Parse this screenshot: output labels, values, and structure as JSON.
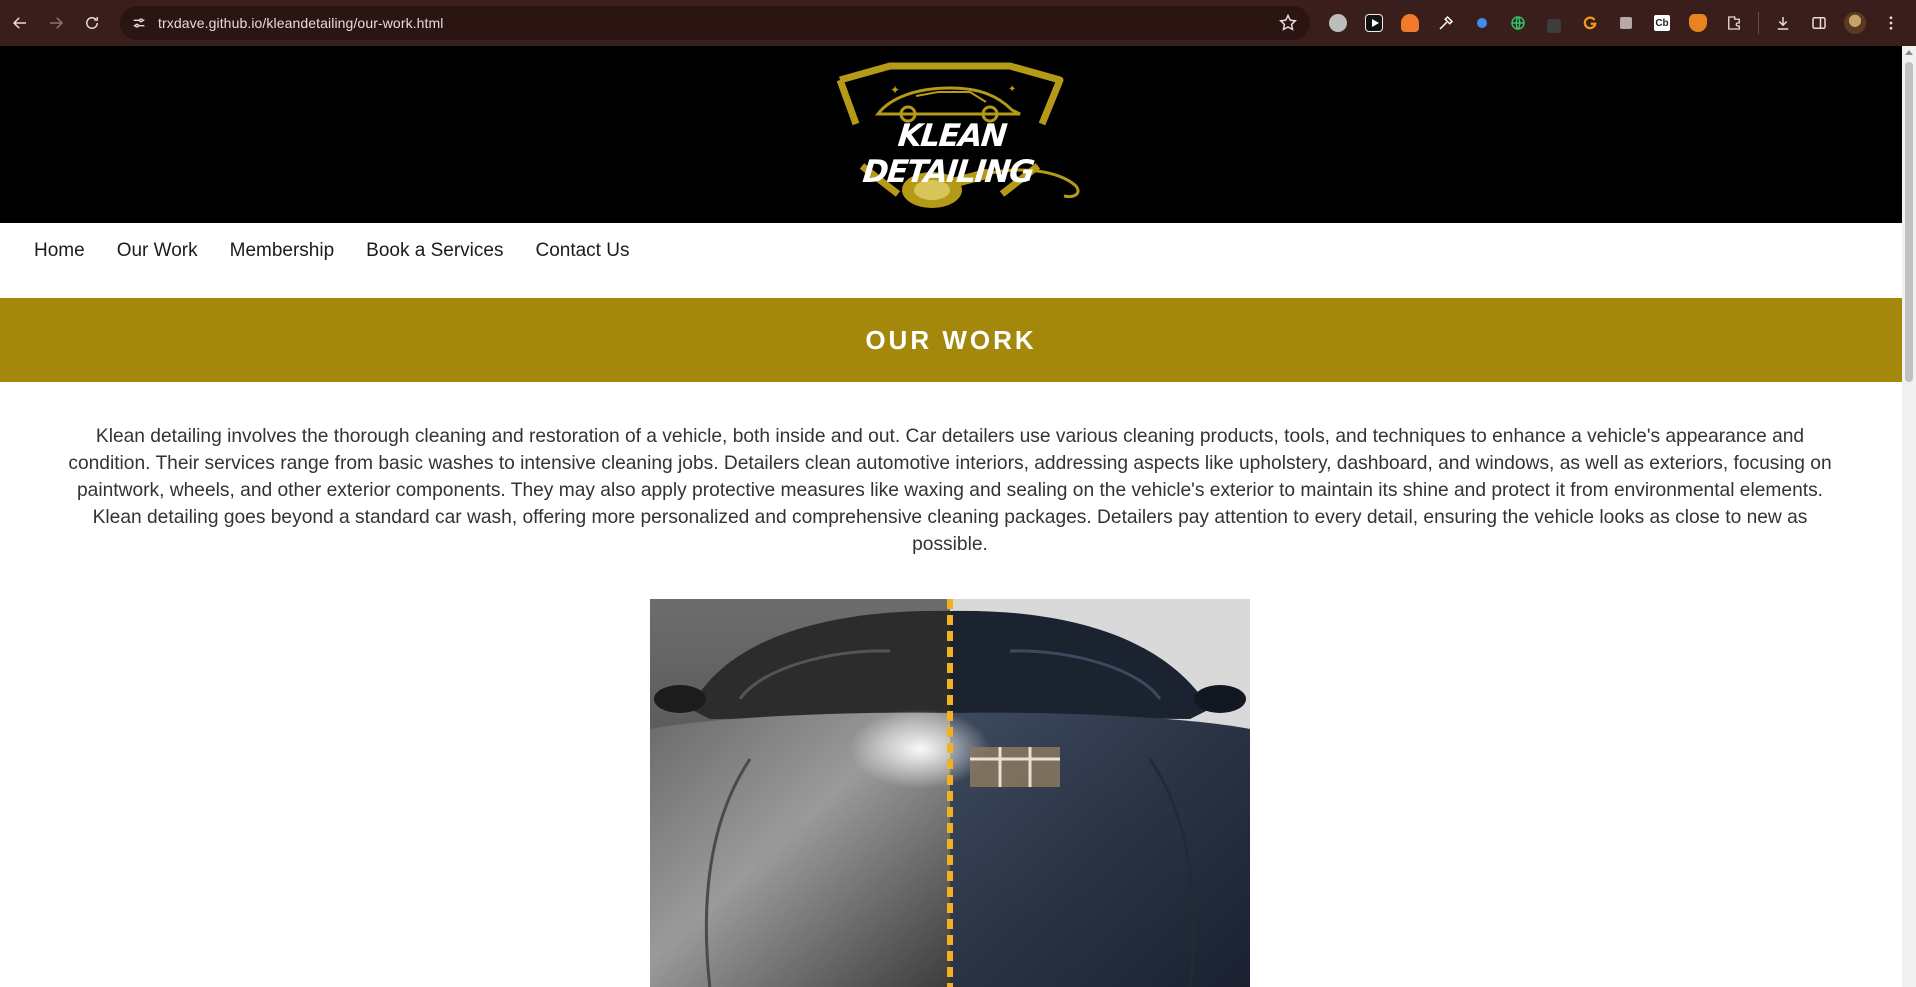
{
  "browser": {
    "url": "trxdave.github.io/kleandetailing/our-work.html",
    "icons": {
      "back": "arrow-left-icon",
      "forward": "arrow-right-icon",
      "reload": "reload-icon",
      "site_info": "tune-icon",
      "bookmark": "star-icon",
      "downloads": "download-icon",
      "side_panel": "side-panel-icon",
      "menu": "kebab-menu-icon"
    },
    "extensions": [
      {
        "name": "grammarly-icon",
        "color": "#bdbdbd"
      },
      {
        "name": "youtube-icon",
        "color": "#ffffff"
      },
      {
        "name": "fox-icon",
        "color": "#f07a2a"
      },
      {
        "name": "eyedropper-icon",
        "color": "#ffffff"
      },
      {
        "name": "blue-dot-icon",
        "color": "#3d8ef0"
      },
      {
        "name": "globe-green-icon",
        "color": "#2cc46a"
      },
      {
        "name": "dark-ext-icon",
        "color": "#5a5a5a"
      },
      {
        "name": "orange-g-icon",
        "color": "#f29a1c"
      },
      {
        "name": "puzzle-ext-icon",
        "color": "#b9a9a6"
      },
      {
        "name": "cb-icon",
        "color": "#ffffff"
      },
      {
        "name": "metamask-icon",
        "color": "#e8831d"
      },
      {
        "name": "extensions-icon",
        "color": "#e8dcd8"
      }
    ]
  },
  "site": {
    "logo_text": "KLEAN DETAILING",
    "colors": {
      "header_bg": "#000000",
      "accent": "#a4880b",
      "logo_gold": "#b59a17"
    }
  },
  "nav": {
    "items": [
      {
        "label": "Home"
      },
      {
        "label": "Our Work"
      },
      {
        "label": "Membership"
      },
      {
        "label": "Book a Services"
      },
      {
        "label": "Contact Us"
      }
    ]
  },
  "banner": {
    "title": "OUR WORK"
  },
  "intro": {
    "text": "Klean detailing involves the thorough cleaning and restoration of a vehicle, both inside and out. Car detailers use various cleaning products, tools, and techniques to enhance a vehicle's appearance and condition. Their services range from basic washes to intensive cleaning jobs. Detailers clean automotive interiors, addressing aspects like upholstery, dashboard, and windows, as well as exteriors, focusing on paintwork, wheels, and other exterior components. They may also apply protective measures like waxing and sealing on the vehicle's exterior to maintain its shine and protect it from environmental elements. Klean detailing goes beyond a standard car wash, offering more personalized and comprehensive cleaning packages. Detailers pay attention to every detail, ensuring the vehicle looks as close to new as possible."
  },
  "photo": {
    "subject": "before-after-car-hood-image",
    "divider_color": "#f2b21c"
  }
}
